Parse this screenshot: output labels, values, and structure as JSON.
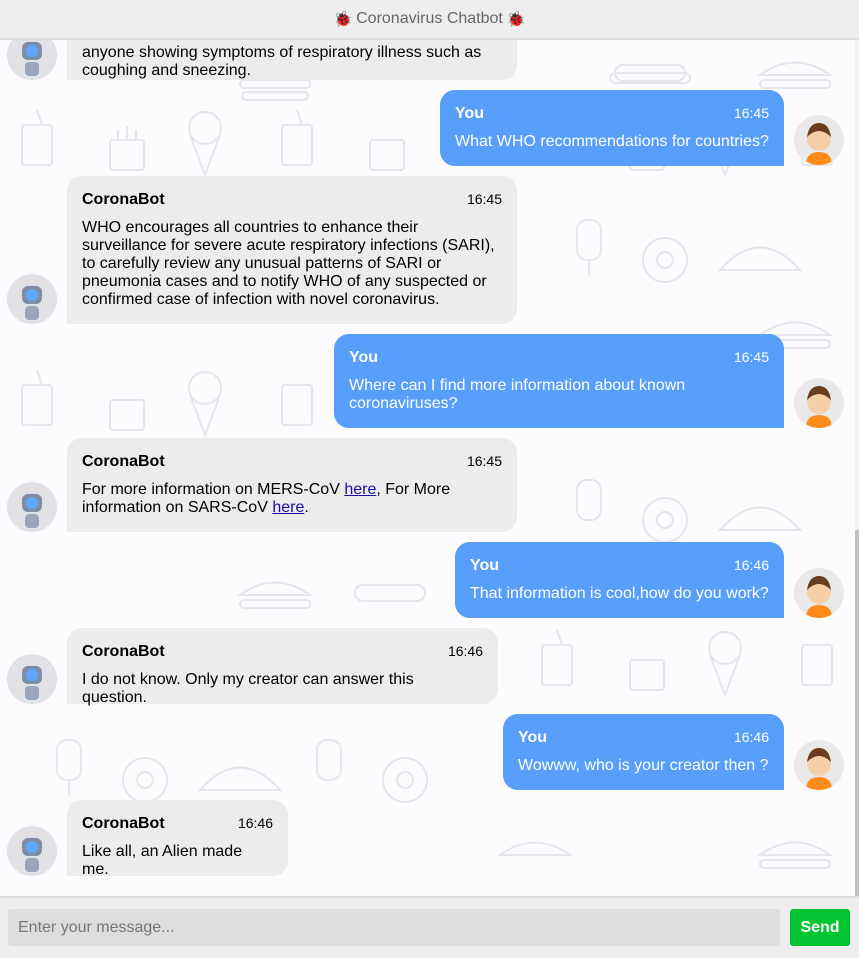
{
  "header": {
    "title": "Coronavirus Chatbot",
    "icon_left": "bug-icon",
    "icon_right": "bug-icon"
  },
  "messages": [
    {
      "sender": "CoronaBot",
      "time": "",
      "text": "anyone showing symptoms of respiratory illness such as coughing and sneezing."
    },
    {
      "sender": "You",
      "time": "16:45",
      "text": "What WHO recommendations for countries?"
    },
    {
      "sender": "CoronaBot",
      "time": "16:45",
      "text": "WHO encourages all countries to enhance their surveillance for severe acute respiratory infections (SARI), to carefully review any unusual patterns of SARI or pneumonia cases and to notify WHO of any suspected or confirmed case of infection with novel coronavirus."
    },
    {
      "sender": "You",
      "time": "16:45",
      "text": "Where can I find more information about known coronaviruses?"
    },
    {
      "sender": "CoronaBot",
      "time": "16:45",
      "text_a": "For more information on MERS-CoV ",
      "link1": "here",
      "text_b": ", For More information on SARS-CoV ",
      "link2": "here",
      "text_c": "."
    },
    {
      "sender": "You",
      "time": "16:46",
      "text": "That information is cool,how do you work?"
    },
    {
      "sender": "CoronaBot",
      "time": "16:46",
      "text": "I do not know. Only my creator can answer this question."
    },
    {
      "sender": "You",
      "time": "16:46",
      "text": "Wowww, who is your creator then ?"
    },
    {
      "sender": "CoronaBot",
      "time": "16:46",
      "text": "Like all, an Alien made me."
    }
  ],
  "input": {
    "placeholder": "Enter your message...",
    "value": ""
  },
  "send_label": "Send",
  "colors": {
    "user_bubble": "#579ffb",
    "bot_bubble": "#ececec",
    "send_button": "#00c531",
    "header_bg": "#eeeeee"
  }
}
